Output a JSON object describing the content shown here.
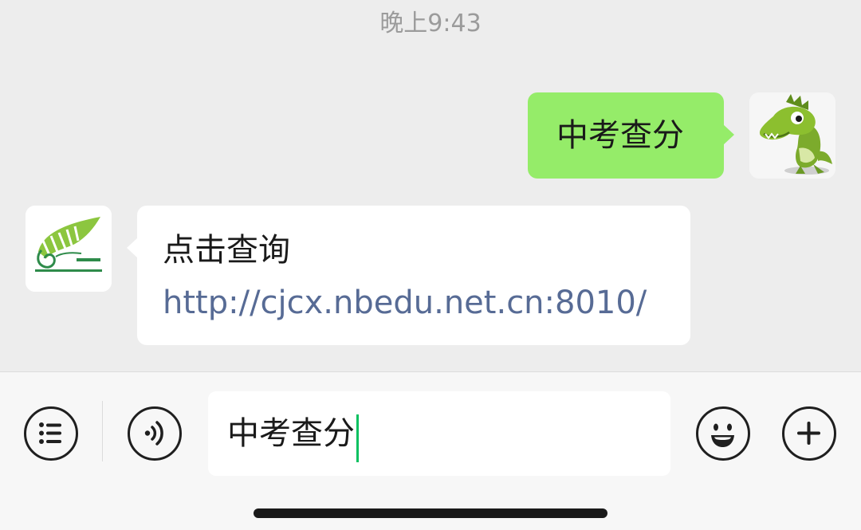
{
  "chat": {
    "timestamp": "晚上9:43",
    "messages": [
      {
        "direction": "outgoing",
        "sender_icon": "green-cartoon-dinosaur-avatar",
        "text": "中考查分"
      },
      {
        "direction": "incoming",
        "sender_icon": "education-bureau-logo-avatar",
        "text": "点击查询",
        "link": "http://cjcx.nbedu.net.cn:8010/"
      }
    ]
  },
  "input_bar": {
    "value": "中考查分",
    "left_buttons": [
      "menu-list-icon",
      "voice-icon"
    ],
    "right_buttons": [
      "emoji-icon",
      "plus-icon"
    ]
  },
  "colors": {
    "chat_background": "#ededed",
    "outgoing_bubble": "#95ec69",
    "incoming_bubble": "#ffffff",
    "link": "#576b95",
    "caret": "#07c160"
  }
}
